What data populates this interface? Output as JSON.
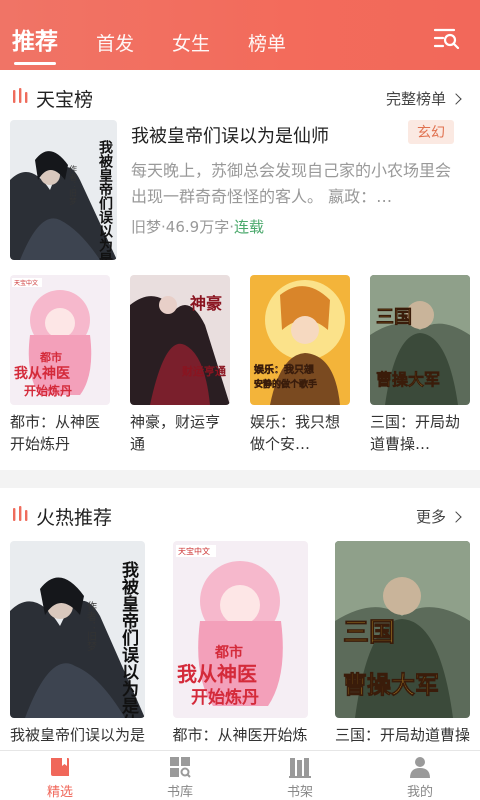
{
  "header": {
    "tabs": [
      {
        "label": "推荐",
        "active": true
      },
      {
        "label": "首发"
      },
      {
        "label": "女生"
      },
      {
        "label": "榜单"
      }
    ],
    "filter_icon": "filter-search-icon",
    "gradient_colors": [
      "#f07466",
      "#f2685a"
    ]
  },
  "section_ranking": {
    "title": "天宝榜",
    "more": "完整榜单",
    "featured": {
      "title": "我被皇帝们误以为是仙师",
      "tag": "玄幻",
      "description": "每天晚上，苏御总会发现自己家的小农场里会出现一群奇奇怪怪的客人。 嬴政：…",
      "author": "旧梦",
      "words": "46.9万字",
      "status": "连载",
      "meta_sep": "·",
      "cover_text": [
        "我被皇帝们误以为是仙师",
        "作者：旧梦"
      ]
    },
    "books": [
      {
        "name": "都市：从神医开始炼丹",
        "cover_text": [
          "都市",
          "我从神医",
          "开始炼丹"
        ],
        "badge": "天宝中文"
      },
      {
        "name": "神豪，财运亨通",
        "cover_text": [
          "神豪",
          "财运亨通"
        ],
        "badge": ""
      },
      {
        "name": "娱乐：我只想做个安…",
        "cover_text": [
          "娱乐：我只想",
          "安静的做个歌手"
        ],
        "badge": ""
      },
      {
        "name": "三国：开局劫道曹操…",
        "cover_text": [
          "三国",
          "曹操大军"
        ],
        "badge": ""
      }
    ]
  },
  "section_hot": {
    "title": "火热推荐",
    "more": "更多",
    "books": [
      {
        "name": "我被皇帝们误以为是仙师",
        "cover_text": [
          "我被皇帝们误以为是仙师",
          "作者：旧梦"
        ]
      },
      {
        "name": "都市：从神医开始炼丹",
        "cover_text": [
          "都市",
          "我从神医",
          "开始炼丹"
        ],
        "badge": "天宝中文"
      },
      {
        "name": "三国：开局劫道曹操大军",
        "cover_text": [
          "三国",
          "曹操大军"
        ]
      }
    ]
  },
  "bottom_nav": [
    {
      "label": "精选",
      "icon": "featured-icon",
      "active": true
    },
    {
      "label": "书库",
      "icon": "library-icon"
    },
    {
      "label": "书架",
      "icon": "bookshelf-icon"
    },
    {
      "label": "我的",
      "icon": "profile-icon"
    }
  ],
  "colors": {
    "accent": "#f0675a",
    "tag_text": "#e0714f",
    "status_green": "#4aa86b"
  }
}
